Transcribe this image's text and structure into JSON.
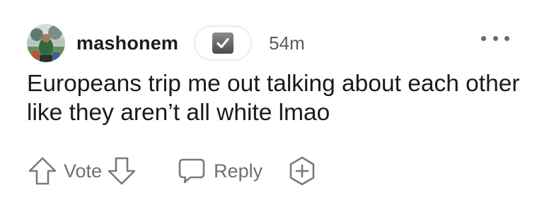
{
  "comment": {
    "username": "mashonem",
    "timestamp": "54m",
    "body": "Europeans trip me out talking about each other like they aren’t all white lmao",
    "flair_icon": "checkmark-box-icon"
  },
  "actions": {
    "vote_label": "Vote",
    "reply_label": "Reply",
    "upvote_icon": "arrow-up-icon",
    "downvote_icon": "arrow-down-icon",
    "reply_icon": "speech-bubble-icon",
    "award_icon": "hexagon-plus-icon",
    "more_icon": "more-horizontal-icon"
  },
  "colors": {
    "text": "#1a1a1b",
    "muted": "#6f6f6f",
    "icon_stroke": "#7a7a7a"
  }
}
